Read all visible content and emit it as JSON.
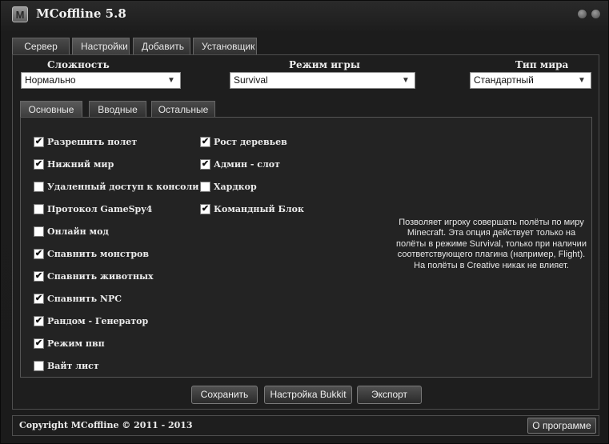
{
  "window": {
    "app_icon_letter": "M",
    "title": "MCoffline 5.8"
  },
  "main_tabs": [
    {
      "label": "Сервер"
    },
    {
      "label": "Настройки"
    },
    {
      "label": "Добавить"
    },
    {
      "label": "Установщик"
    }
  ],
  "main_tabs_active": "Настройки",
  "dropdowns": {
    "difficulty": {
      "label": "Сложность",
      "value": "Нормально"
    },
    "gamemode": {
      "label": "Режим игры",
      "value": "Survival"
    },
    "world_type": {
      "label": "Тип мира",
      "value": "Стандартный"
    }
  },
  "sub_tabs": [
    {
      "label": "Основные"
    },
    {
      "label": "Вводные"
    },
    {
      "label": "Остальные"
    }
  ],
  "sub_tabs_active": "Основные",
  "checkboxes_left": [
    {
      "label": "Разрешить полет",
      "checked": true
    },
    {
      "label": "Нижний мир",
      "checked": true
    },
    {
      "label": "Удаленный доступ к консоли",
      "checked": false
    },
    {
      "label": "Протокол GameSpy4",
      "checked": false
    },
    {
      "label": "Онлайн мод",
      "checked": false
    },
    {
      "label": "Спавнить монстров",
      "checked": true
    },
    {
      "label": "Спавнить животных",
      "checked": true
    },
    {
      "label": "Спавнить NPC",
      "checked": true
    },
    {
      "label": "Рандом - Генератор",
      "checked": true
    },
    {
      "label": "Режим пвп",
      "checked": true
    },
    {
      "label": "Вайт лист",
      "checked": false
    }
  ],
  "checkboxes_right": [
    {
      "label": "Рост деревьев",
      "checked": true
    },
    {
      "label": "Админ - слот",
      "checked": true
    },
    {
      "label": "Хардкор",
      "checked": false
    },
    {
      "label": "Командный Блок",
      "checked": true
    }
  ],
  "description": "Позволяет игроку совершать полёты по миру Minecraft. Эта опция действует только на полёты в режиме Survival, только при наличии соответствующего плагина (например, Flight). На полёты в Creative никак не влияет.",
  "buttons": {
    "save": "Сохранить",
    "bukkit": "Настройка Bukkit",
    "export": "Экспорт"
  },
  "footer": {
    "copyright": "Copyright MCoffline © 2011 - 2013",
    "about": "О программе"
  },
  "icons": {
    "app": "minecraft-m-icon",
    "minimize": "minimize-orb-icon",
    "close": "close-orb-icon",
    "dropdown": "chevron-down-icon",
    "checkbox": "checkmark-icon"
  }
}
